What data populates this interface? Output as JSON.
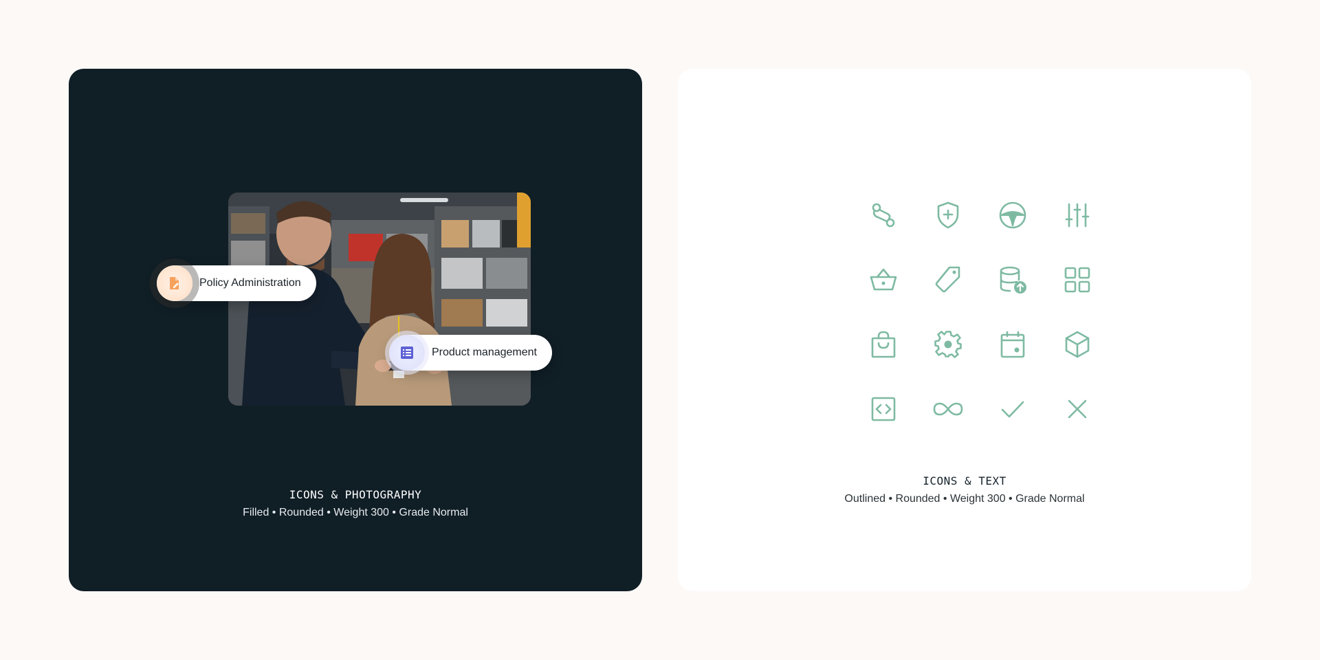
{
  "colors": {
    "page_bg": "#fdf9f7",
    "dark_card": "#101e26",
    "light_card": "#ffffff",
    "icon_green": "#7ebaa2",
    "policy_icon": "#f6a15d",
    "product_icon": "#5d61d4"
  },
  "left_card": {
    "caption_title": "ICONS & PHOTOGRAPHY",
    "caption_sub": "Filled • Rounded • Weight 300 • Grade Normal",
    "pills": {
      "policy": {
        "label": "Policy Administration",
        "icon": "document-edit-icon"
      },
      "product": {
        "label": "Product management",
        "icon": "list-icon"
      }
    },
    "photo": {
      "subject": "two-people-in-electronics-store-photo"
    }
  },
  "right_card": {
    "caption_title": "ICONS & TEXT",
    "caption_sub": "Outlined • Rounded • Weight 300 • Grade Normal",
    "icons": [
      "route-icon",
      "shield-plus-icon",
      "steering-wheel-icon",
      "sliders-icon",
      "basket-icon",
      "tag-icon",
      "database-upload-icon",
      "grid-icon",
      "shopping-bag-icon",
      "gear-icon",
      "calendar-icon",
      "cube-icon",
      "code-icon",
      "infinity-icon",
      "check-icon",
      "close-icon"
    ]
  }
}
